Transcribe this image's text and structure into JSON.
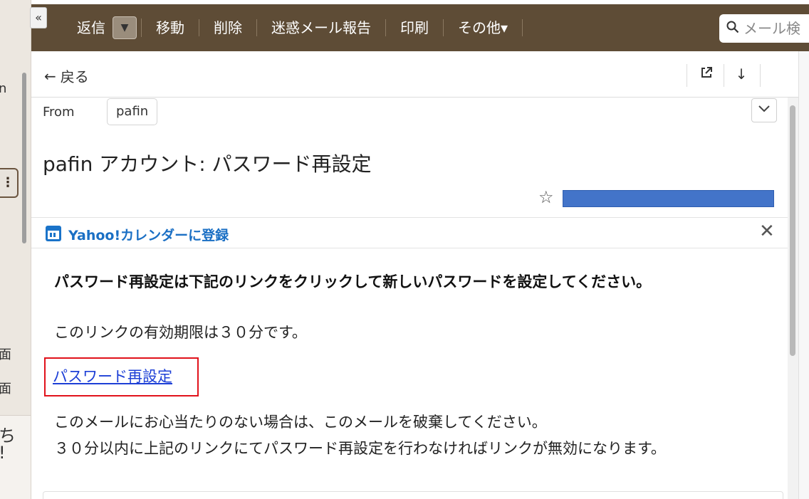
{
  "sidebar": {
    "collapse_icon": "«",
    "cutoff_text_1": "n",
    "cutoff_text_2": "面",
    "cutoff_text_3": "面",
    "cutoff_text_4": "ち",
    "cutoff_text_5": "!"
  },
  "toolbar": {
    "reply": "返信",
    "move": "移動",
    "delete": "削除",
    "spam": "迷惑メール報告",
    "print": "印刷",
    "more": "その他",
    "more_caret": "▾",
    "search_placeholder": "メール検"
  },
  "action_bar": {
    "back_label": "戻る"
  },
  "mail": {
    "from_label": "From",
    "from_name": "pafin",
    "subject": "pafin アカウント: パスワード再設定",
    "calendar_link": "Yahoo!カレンダーに登録",
    "body_bold": "パスワード再設定は下記のリンクをクリックして新しいパスワードを設定してください。",
    "validity": "このリンクの有効期限は３０分です。",
    "reset_link": "パスワード再設定",
    "note_1": "このメールにお心当たりのない場合は、このメールを破棄してください。",
    "note_2": "３０分以内に上記のリンクにてパスワード再設定を行わなければリンクが無効になります。"
  },
  "colors": {
    "toolbar_bg": "#5e4c36",
    "link_blue": "#1d3fd6",
    "calendar_blue": "#1a6fc4",
    "highlight_red": "#e1121b",
    "redaction_blue": "#4374c9"
  }
}
